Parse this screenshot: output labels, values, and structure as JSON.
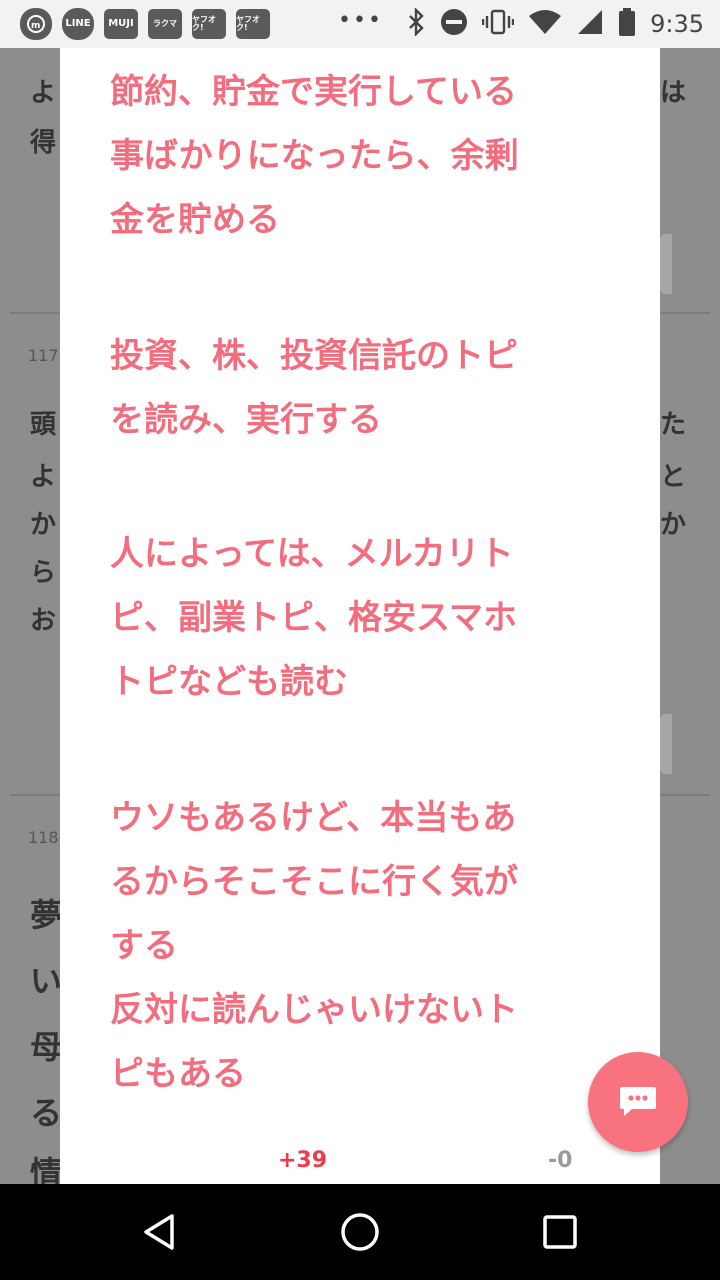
{
  "status_bar": {
    "time": "9:35",
    "notification_icons": [
      "LINE",
      "MUJI",
      "ラクマ",
      "ヤフオク!",
      "ヤフオク!"
    ],
    "overflow": "•••",
    "system_icons": [
      "bluetooth-icon",
      "do-not-disturb-icon",
      "vibrate-icon",
      "wifi-icon",
      "signal-icon",
      "battery-icon"
    ]
  },
  "background": {
    "post_numbers": [
      "117",
      "118"
    ],
    "left_fragments": [
      "よ",
      "得",
      "頭",
      "よ",
      "か",
      "ら",
      "お",
      "夢",
      "い",
      "母",
      "る",
      "情"
    ],
    "right_fragments": [
      "は",
      "た",
      "と",
      "か"
    ]
  },
  "modal": {
    "paragraphs": [
      {
        "lines": [
          "節約、貯金で実行している",
          "事ばかりになったら、余剰",
          "金を貯める"
        ]
      },
      {
        "lines": [
          "投資、株、投資信託のトピ",
          "を読み、実行する"
        ]
      },
      {
        "lines": [
          "人によっては、メルカリト",
          "ピ、副業トピ、格安スマホ",
          "トピなども読む"
        ]
      },
      {
        "lines": [
          "ウソもあるけど、本当もあ",
          "るからそこそこに行く気が",
          "する",
          "反対に読んじゃいけないト",
          "ピもある"
        ]
      }
    ],
    "votes": {
      "plus": "+39",
      "minus": "-0"
    }
  },
  "colors": {
    "accent_text": "#f26d7d",
    "plus_vote": "#ef3a4c",
    "fab": "#f8737f"
  },
  "nav": {
    "back": "back-icon",
    "home": "home-icon",
    "recents": "recents-icon"
  }
}
